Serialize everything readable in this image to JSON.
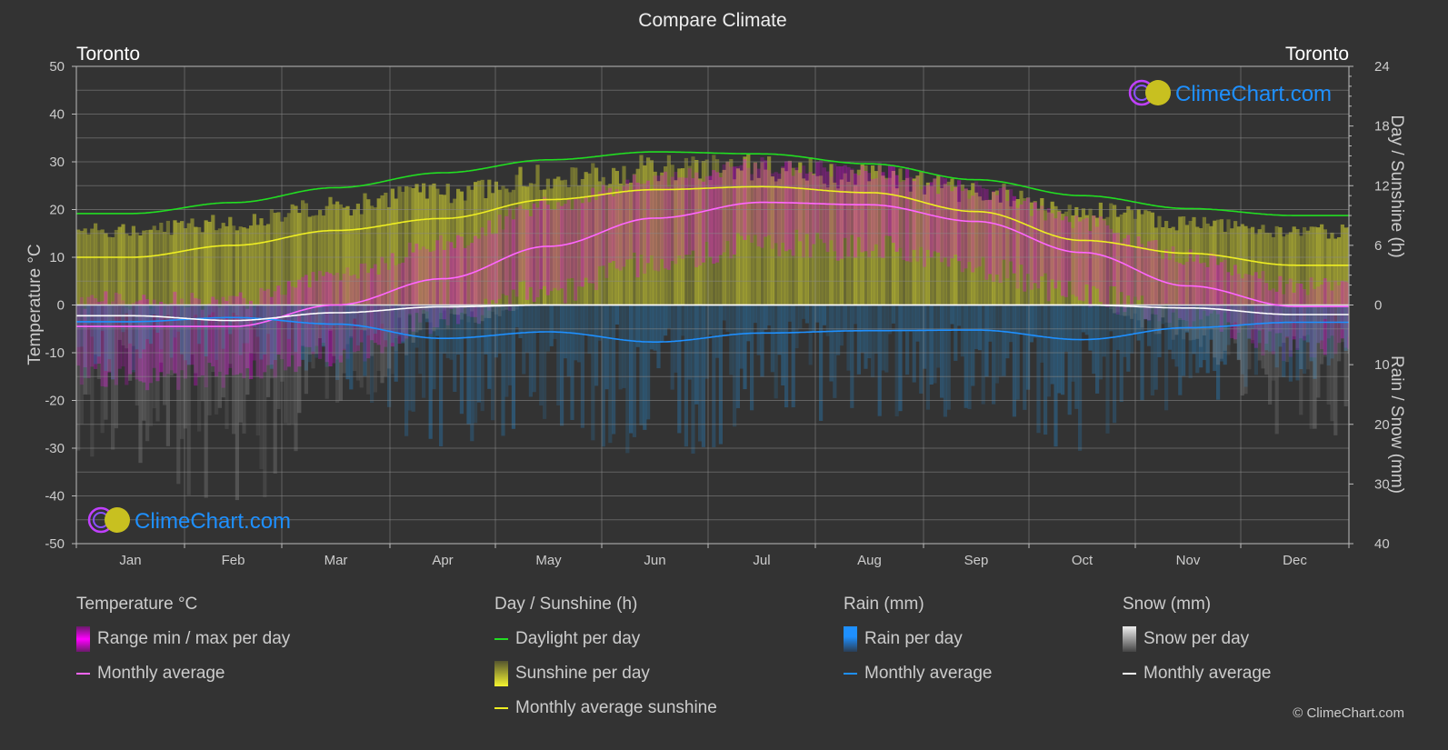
{
  "header": {
    "title": "Compare Climate",
    "city_left": "Toronto",
    "city_right": "Toronto"
  },
  "watermark": "ClimeChart.com",
  "copyright": "© ClimeChart.com",
  "colors": {
    "background": "#333333",
    "daylight": "#22dd22",
    "sunshine_avg": "#eeee22",
    "temp_avg": "#ff66ff",
    "rain_avg": "#1e90ff",
    "snow_avg": "#ffffff",
    "temp_range": "#ee00ee",
    "sunshine_bar": "#c8c832",
    "rain_bar": "#2a6fa0",
    "snow_bar": "#9a9a9a"
  },
  "chart_data": {
    "type": "line",
    "title": "Compare Climate",
    "categories": [
      "Jan",
      "Feb",
      "Mar",
      "Apr",
      "May",
      "Jun",
      "Jul",
      "Aug",
      "Sep",
      "Oct",
      "Nov",
      "Dec"
    ],
    "axes": {
      "left": {
        "label": "Temperature °C",
        "range": [
          -50,
          50
        ],
        "ticks": [
          50,
          40,
          30,
          20,
          10,
          0,
          -10,
          -20,
          -30,
          -40,
          -50
        ]
      },
      "right_top": {
        "label": "Day / Sunshine (h)",
        "range": [
          0,
          24
        ],
        "ticks": [
          24,
          18,
          12,
          6,
          0
        ]
      },
      "right_bottom": {
        "label": "Rain / Snow (mm)",
        "range": [
          0,
          40
        ],
        "ticks": [
          0,
          10,
          20,
          30,
          40
        ]
      }
    },
    "grid": true,
    "series": [
      {
        "name": "Daylight per day",
        "axis": "right_top",
        "unit": "h",
        "values": [
          9.2,
          10.3,
          11.8,
          13.3,
          14.6,
          15.4,
          15.2,
          14.2,
          12.6,
          11.0,
          9.7,
          9.0
        ]
      },
      {
        "name": "Monthly average sunshine",
        "axis": "right_top",
        "unit": "h",
        "values": [
          4.8,
          6.0,
          7.5,
          8.7,
          10.6,
          11.6,
          11.9,
          11.3,
          9.4,
          6.5,
          5.2,
          4.0
        ]
      },
      {
        "name": "Temperature monthly average",
        "axis": "left",
        "unit": "°C",
        "values": [
          -4.5,
          -4.5,
          0.0,
          5.5,
          12.3,
          18.2,
          21.5,
          21.0,
          17.5,
          11.0,
          4.0,
          -0.3
        ]
      },
      {
        "name": "Rain monthly average",
        "axis": "right_bottom",
        "unit": "mm",
        "values": [
          2.8,
          2.1,
          3.2,
          5.6,
          4.5,
          6.2,
          4.7,
          4.3,
          4.2,
          5.8,
          3.8,
          2.9
        ]
      },
      {
        "name": "Snow monthly average",
        "axis": "right_bottom",
        "unit": "mm",
        "values": [
          1.8,
          2.6,
          1.3,
          0.3,
          0.0,
          0.0,
          0.0,
          0.0,
          0.0,
          0.0,
          0.5,
          1.6
        ]
      }
    ],
    "bands": [
      {
        "name": "Sunshine per day (area)",
        "axis": "right_top",
        "upper_h": [
          8.0,
          8.8,
          10.5,
          12.0,
          13.6,
          14.5,
          14.6,
          13.5,
          12.0,
          10.2,
          8.7,
          7.8
        ]
      },
      {
        "name": "Range min / max per day",
        "axis": "left",
        "min": [
          -12,
          -12,
          -7,
          0,
          6,
          12,
          16,
          15,
          11,
          5,
          0,
          -6
        ],
        "max": [
          -1,
          -1,
          4,
          11,
          19,
          24,
          27,
          26,
          22,
          15,
          8,
          2
        ]
      }
    ],
    "legend_position": "bottom"
  },
  "legend": {
    "groups": [
      {
        "title": "Temperature °C",
        "items": [
          {
            "label": "Range min / max per day",
            "kind": "bar",
            "swatch": "temp-range"
          },
          {
            "label": "Monthly average",
            "kind": "line",
            "swatch": "temp-avg"
          }
        ]
      },
      {
        "title": "Day / Sunshine (h)",
        "items": [
          {
            "label": "Daylight per day",
            "kind": "line",
            "swatch": "daylight"
          },
          {
            "label": "Sunshine per day",
            "kind": "bar",
            "swatch": "sunshine"
          },
          {
            "label": "Monthly average sunshine",
            "kind": "line",
            "swatch": "sunshine-avg"
          }
        ]
      },
      {
        "title": "Rain (mm)",
        "items": [
          {
            "label": "Rain per day",
            "kind": "bar",
            "swatch": "rain"
          },
          {
            "label": "Monthly average",
            "kind": "line",
            "swatch": "rain-avg"
          }
        ]
      },
      {
        "title": "Snow (mm)",
        "items": [
          {
            "label": "Snow per day",
            "kind": "bar",
            "swatch": "snow"
          },
          {
            "label": "Monthly average",
            "kind": "line",
            "swatch": "snow-avg"
          }
        ]
      }
    ]
  }
}
